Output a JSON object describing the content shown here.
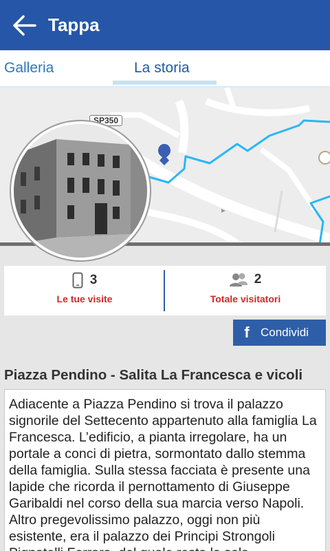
{
  "appbar": {
    "title": "Tappa",
    "back_icon": "arrow-left-icon"
  },
  "tabs": [
    {
      "label": "Galleria"
    },
    {
      "label": "La storia"
    }
  ],
  "map": {
    "road_label": "SP350"
  },
  "stats": {
    "visits": {
      "count": "3",
      "label": "Le tue visite",
      "icon": "phone-icon"
    },
    "visitors": {
      "count": "2",
      "label": "Totale visitatori",
      "icon": "people-icon"
    }
  },
  "share": {
    "label": "Condividi",
    "icon": "facebook-icon"
  },
  "place": {
    "title": "Piazza Pendino - Salita La Francesca e vicoli",
    "description": "Adiacente a Piazza Pendino si trova il palazzo signorile del Settecento appartenuto alla famiglia La Francesca. L’edificio, a pianta irregolare, ha un portale a conci di pietra, sormontato dallo stemma della famiglia. Sulla stessa facciata è presente una lapide che ricorda il pernottamento di Giuseppe Garibaldi nel corso della sua marcia verso Napoli. Altro pregevolissimo palazzo, oggi non più esistente, era il palazzo dei Principi Strongoli Pignatelli Ferrara, del quale resta la sola"
  },
  "colors": {
    "appbar": "#2656a7",
    "accent_red": "#d2282a",
    "route": "#29b6f6"
  }
}
